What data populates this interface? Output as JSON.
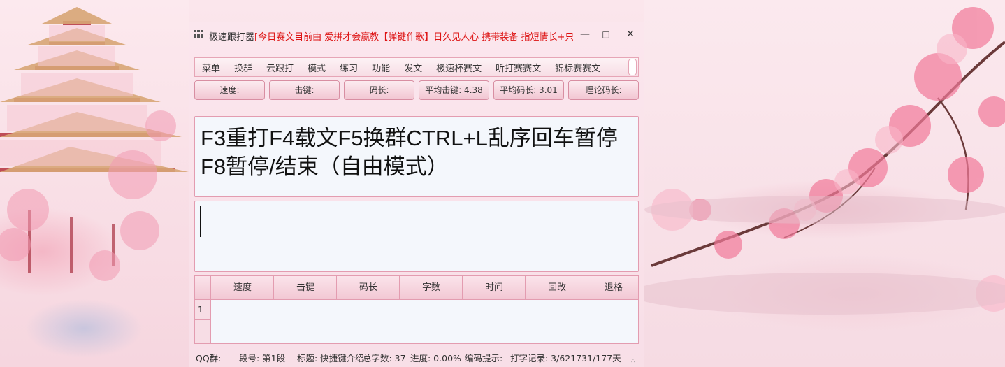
{
  "window": {
    "title": "极速跟打器",
    "marquee": "[今日赛文目前由 爱拼才会赢教【弹键作歌】日久见人心 携带装备 指短情长+只!",
    "min_icon": "minimize-icon",
    "max_icon": "maximize-icon",
    "close_icon": "close-icon"
  },
  "menu": {
    "items": [
      "菜单",
      "换群",
      "云跟打",
      "模式",
      "练习",
      "功能",
      "发文",
      "极速杯赛文",
      "听打赛赛文",
      "锦标赛赛文"
    ]
  },
  "stats": {
    "speed": "速度:",
    "keystroke": "击键:",
    "code_len": "码长:",
    "avg_keystroke": "平均击键: 4.38",
    "avg_code_len": "平均码长: 3.01",
    "theory_code_len": "理论码长:"
  },
  "article": {
    "text": "F3重打F4载文F5换群CTRL+L乱序回车暂停F8暂停/结束（自由模式）"
  },
  "input": {
    "value": ""
  },
  "results": {
    "columns": [
      "速度",
      "击键",
      "码长",
      "字数",
      "时间",
      "回改",
      "退格"
    ],
    "rows": [
      "1"
    ]
  },
  "status": {
    "qq_group": "QQ群:",
    "segment": "段号: 第1段",
    "title": "标题: 快捷键介绍",
    "total_chars": "总字数: 37",
    "progress": "进度: 0.00%",
    "hint": "编码提示:",
    "record": "打字记录: 3/621731/177天"
  },
  "colors": {
    "accent": "#e39cb0",
    "marquee": "#dd1111",
    "panel": "#f4f7fc"
  }
}
